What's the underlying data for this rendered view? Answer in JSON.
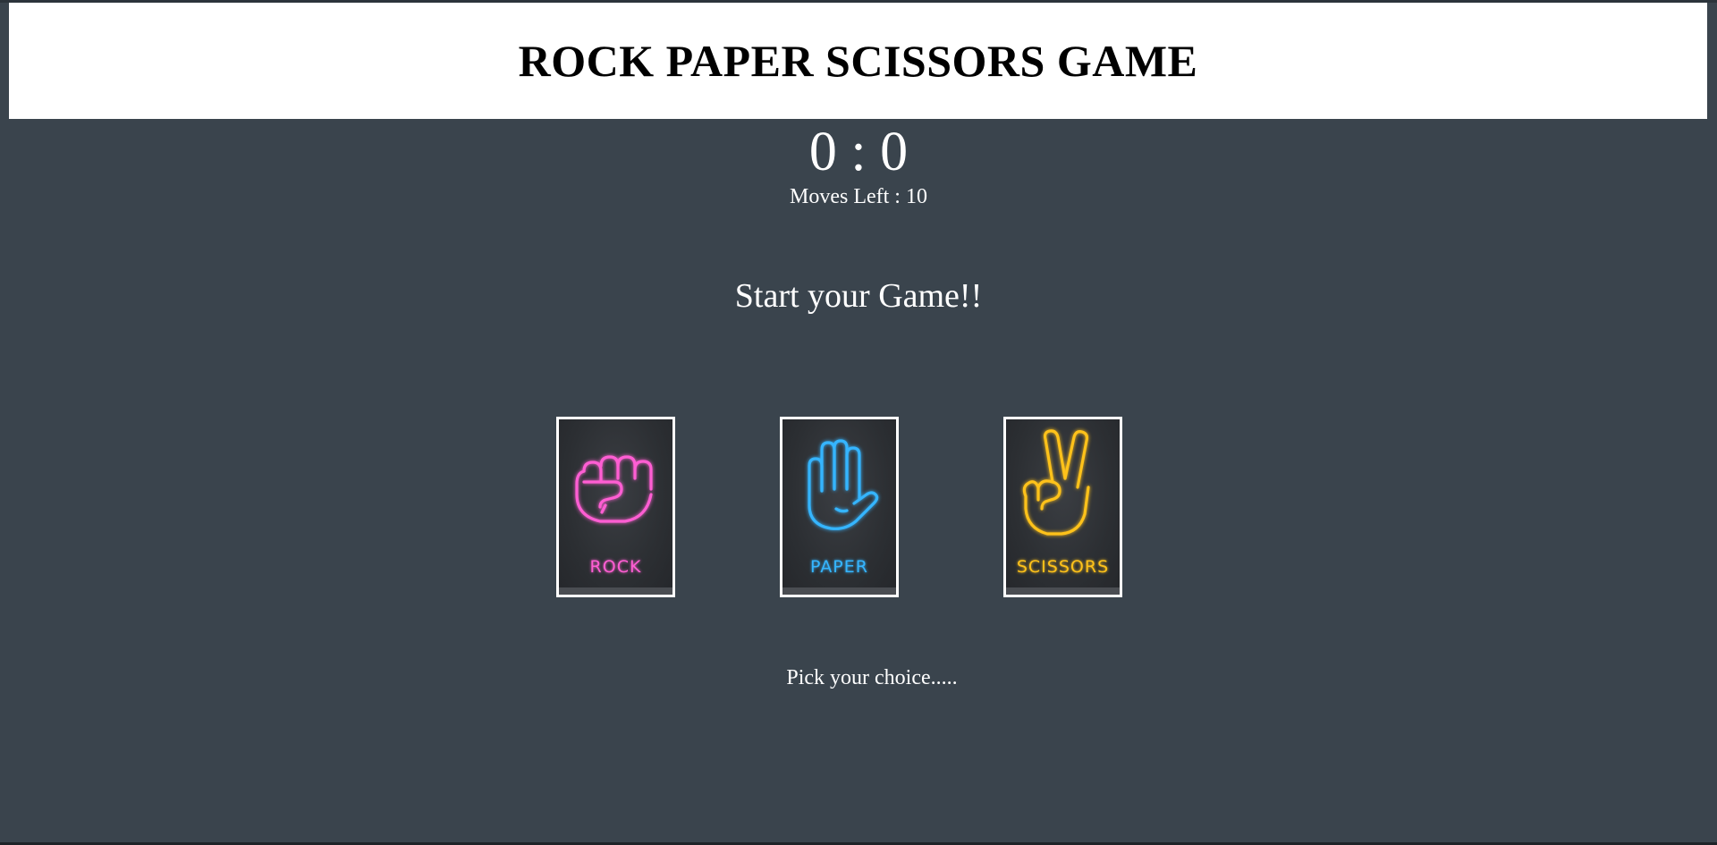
{
  "header": {
    "title": "ROCK PAPER SCISSORS GAME"
  },
  "score": {
    "display": "0 : 0",
    "user": 0,
    "computer": 0
  },
  "moves": {
    "text": "Moves Left : 10",
    "remaining": 10
  },
  "status": {
    "message": "Start your Game!!"
  },
  "choices": [
    {
      "id": "rock",
      "label": "ROCK",
      "color": "#ff5ed3",
      "icon": "fist-icon"
    },
    {
      "id": "paper",
      "label": "PAPER",
      "color": "#35b5ff",
      "icon": "open-hand-icon"
    },
    {
      "id": "scissors",
      "label": "SCISSORS",
      "color": "#ffc21a",
      "icon": "peace-sign-icon"
    }
  ],
  "prompt": {
    "text": "Pick your choice....."
  },
  "colors": {
    "background": "#3a444d",
    "header_bg": "#ffffff",
    "text": "#ffffff"
  }
}
